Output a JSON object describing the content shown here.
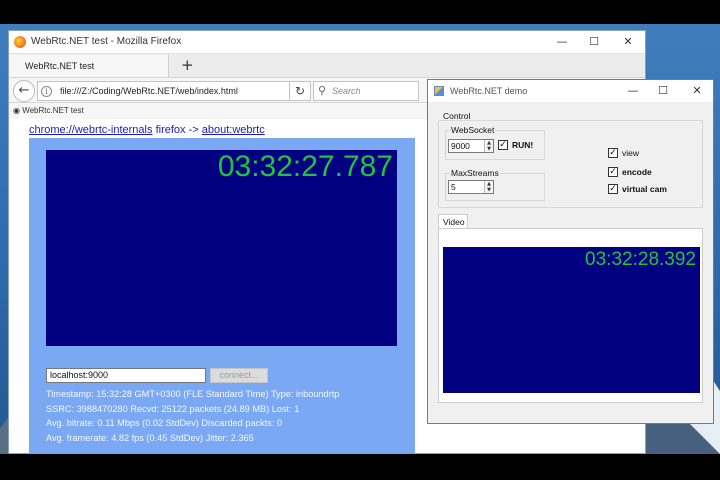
{
  "firefox": {
    "window_title": "WebRtc.NET test - Mozilla Firefox",
    "tab_title": "WebRtc.NET test",
    "new_tab": "+",
    "url": "file:///Z:/Coding/WebRtc.NET/web/index.html",
    "search_placeholder": "Search",
    "bookmark_label": "WebRtc.NET test",
    "controls": {
      "minimize": "—",
      "maximize": "☐",
      "close": "✕"
    }
  },
  "page": {
    "links": {
      "chrome_link": "chrome://webrtc-internals",
      "firefox_text": "firefox ->",
      "firefox_link": "about:webrtc"
    },
    "timestamp_overlay": "03:32:27.787",
    "server_input_value": "localhost:9000",
    "connect_button": "connect...",
    "stats": [
      "Timestamp: 15:32:28 GMT+0300 (FLE Standard Time) Type: inboundrtp",
      "SSRC: 3988470280 Recvd: 25122 packets (24.89 MB) Lost: 1",
      "Avg. bitrate: 0.11 Mbps (0.02 StdDev) Discarded packts: 0",
      "Avg. framerate: 4.82 fps (0.45 StdDev) Jitter: 2.365"
    ]
  },
  "demo": {
    "window_title": "WebRtc.NET demo",
    "controls": {
      "minimize": "—",
      "maximize": "☐",
      "close": "✕"
    },
    "control_group_label": "Control",
    "websocket_label": "WebSocket",
    "websocket_port": "9000",
    "run_label": "RUN!",
    "run_checked": true,
    "maxstreams_label": "MaxStreams",
    "maxstreams_value": "5",
    "view_label": "view",
    "view_checked": true,
    "encode_label": "encode",
    "encode_checked": true,
    "virtual_cam_label": "virtual cam",
    "virtual_cam_checked": true,
    "video_tab": "Video",
    "timestamp_overlay": "03:32:28.392"
  },
  "colors": {
    "video_bg": "#000080",
    "timestamp_green": "#21c43f",
    "page_panel": "#7aa8f3"
  }
}
